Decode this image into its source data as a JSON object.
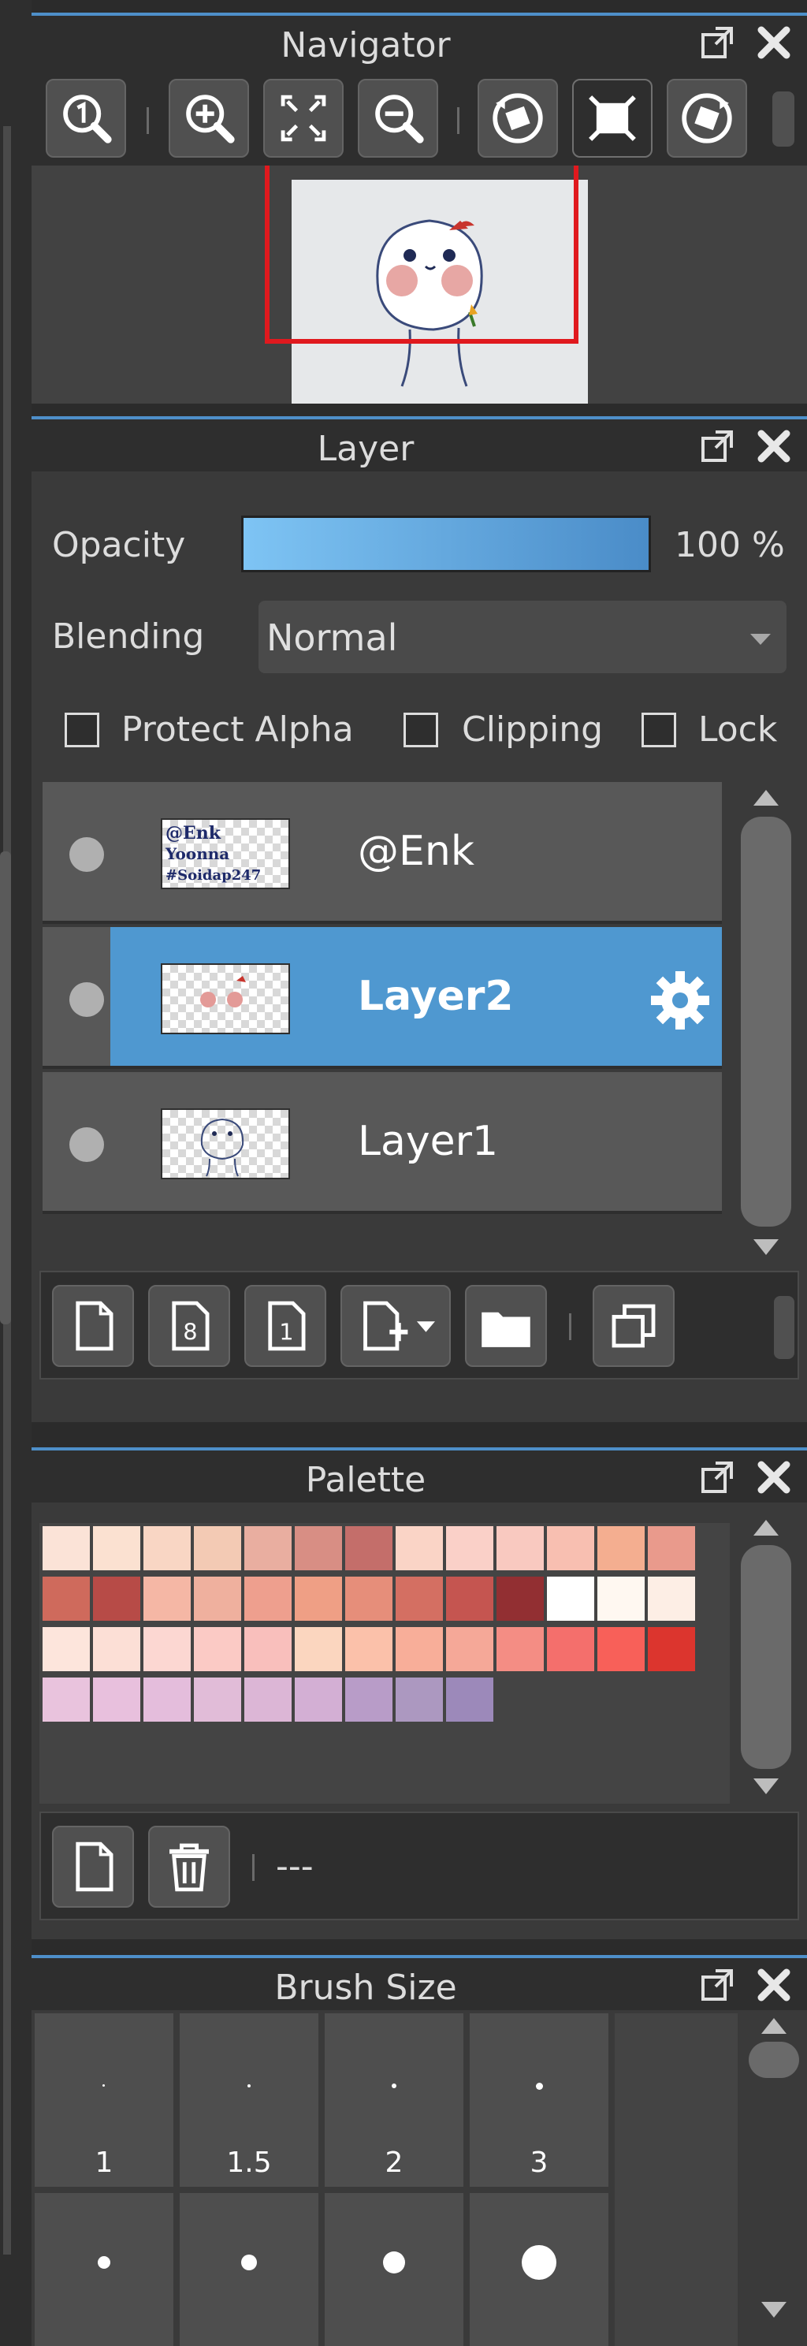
{
  "navigator": {
    "title": "Navigator",
    "toolbar": [
      "actual-size",
      "zoom-in",
      "fit-screen",
      "zoom-out",
      "rotate-left",
      "reset-view",
      "rotate-right"
    ]
  },
  "layer": {
    "title": "Layer",
    "opacity_label": "Opacity",
    "opacity_value": "100 %",
    "opacity_fraction": 1.0,
    "blending_label": "Blending",
    "blending_value": "Normal",
    "options": [
      {
        "label": "Protect Alpha",
        "checked": false
      },
      {
        "label": "Clipping",
        "checked": false
      },
      {
        "label": "Lock",
        "checked": false
      }
    ],
    "rows": [
      {
        "name": "@Enk",
        "thumb_text": "@Enk\nYoonna\n#Soidap247",
        "selected": false
      },
      {
        "name": "Layer2",
        "selected": true
      },
      {
        "name": "Layer1",
        "selected": false
      }
    ]
  },
  "palette": {
    "title": "Palette",
    "current_name": "---",
    "colors": [
      [
        "#fbe3d7",
        "#fbe1d1",
        "#f9d6c4",
        "#f3cab4",
        "#e9aea0",
        "#d88e84",
        "#c46e6a",
        "#fad4c6",
        "#fad0c8",
        "#f9c9c0",
        "#f8bfb1",
        "#f4ae90",
        "#e99a8c"
      ],
      [
        "#cf6a5c",
        "#b74b47",
        "#f5b7a5",
        "#efb09e",
        "#ee9f8e",
        "#ef9f85",
        "#e68e7a",
        "#d46f62",
        "#c55550",
        "#922f32",
        "#ffffff",
        "#fff8f1",
        "#fdeee5"
      ],
      [
        "#fde5dc",
        "#fcdfd6",
        "#fcd7d2",
        "#fbcac5",
        "#f9bfbc",
        "#fbd6bf",
        "#fbc1aa",
        "#f8ae99",
        "#f5a898",
        "#f48d84",
        "#f46f6c",
        "#f86059",
        "#dc352e"
      ],
      [
        "#e9c3dd",
        "#e8c0dd",
        "#e4bddc",
        "#e1bcd8",
        "#dcb6d6",
        "#d3afd4",
        "#b89cc8",
        "#ac98c0",
        "#9c89ba"
      ]
    ]
  },
  "brush_size": {
    "title": "Brush Size",
    "sizes": [
      "1",
      "1.5",
      "2",
      "3"
    ]
  },
  "colors": {
    "accent": "#4e8fc9",
    "selected_row": "#4f98d0",
    "opacity_bar_start": "#7ec4f4",
    "opacity_bar_end": "#4a8cc8",
    "navigator_frame": "#e0191e"
  }
}
